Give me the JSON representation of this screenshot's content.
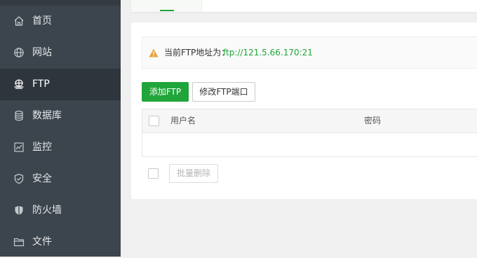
{
  "colors": {
    "sidebar_bg": "#3c444d",
    "sidebar_active_bg": "#2e353c",
    "accent": "#20a53a",
    "warning": "#e6a23c"
  },
  "sidebar": {
    "items": [
      {
        "label": "首页",
        "icon": "home-icon",
        "active": false
      },
      {
        "label": "网站",
        "icon": "globe-icon",
        "active": false
      },
      {
        "label": "FTP",
        "icon": "ftp-icon",
        "active": true
      },
      {
        "label": "数据库",
        "icon": "database-icon",
        "active": false
      },
      {
        "label": "监控",
        "icon": "monitor-icon",
        "active": false
      },
      {
        "label": "安全",
        "icon": "shield-icon",
        "active": false
      },
      {
        "label": "防火墙",
        "icon": "firewall-icon",
        "active": false
      },
      {
        "label": "文件",
        "icon": "folder-icon",
        "active": false
      }
    ]
  },
  "ftp_address": {
    "icon": "warning-icon",
    "label": "当前FTP地址为：",
    "value": "ftp://121.5.66.170:21"
  },
  "toolbar": {
    "add_label": "添加FTP",
    "modify_port_label": "修改FTP端口"
  },
  "table": {
    "columns": [
      "用户名",
      "密码"
    ],
    "rows": []
  },
  "footer": {
    "batch_delete_label": "批量删除"
  }
}
